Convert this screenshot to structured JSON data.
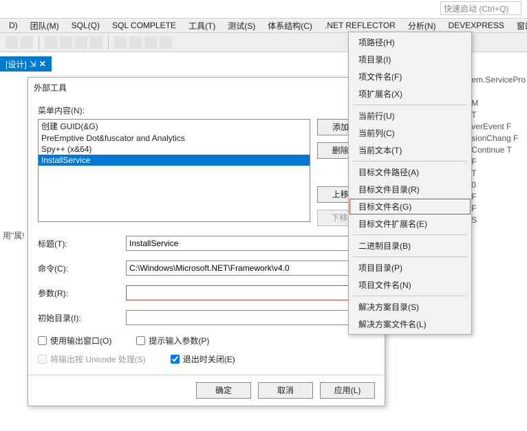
{
  "quicklaunch_placeholder": "快速启动 (Ctrl+Q)",
  "menubar": [
    "D)",
    "团队(M)",
    "SQL(Q)",
    "SQL COMPLETE",
    "工具(T)",
    "测试(S)",
    "体系结构(C)",
    ".NET REFLECTOR",
    "分析(N)",
    "DEVEXPRESS",
    "窗口"
  ],
  "doctab": {
    "label": "[设计]",
    "pin": "⇲",
    "close": "✕"
  },
  "hint_text": "用\"属!",
  "peek_lines": [
    "em.ServicePro",
    "",
    "M",
    "T",
    "verEvent    F",
    "sionChang  F",
    "Continue    T",
    "F",
    "T",
    "0",
    "F",
    "F",
    "S"
  ],
  "dialog": {
    "title": "外部工具",
    "help": "?",
    "close": "✕",
    "label_menu": "菜单内容(N):",
    "list": [
      "创建 GUID(&G)",
      "PreEmptive Dot&fuscator and Analytics",
      "Spy++ (x&64)",
      "InstallService"
    ],
    "selected_index": 3,
    "btns": {
      "add": "添加(A)",
      "del": "删除(D)",
      "up": "上移(U)",
      "down": "下移(W)"
    },
    "fields": {
      "title_lbl": "标题(T):",
      "title_val": "InstallService",
      "cmd_lbl": "命令(C):",
      "cmd_val": "C:\\Windows\\Microsoft.NET\\Framework\\v4.0",
      "args_lbl": "参数(R):",
      "args_val": "",
      "initdir_lbl": "初始目录(I):",
      "initdir_val": ""
    },
    "chk": {
      "useoutput": "使用输出窗口(O)",
      "prompt": "提示输入参数(P)",
      "unicode": "将输出按 Unicode 处理(S)",
      "closeonexit": "退出时关闭(E)"
    },
    "footer": {
      "ok": "确定",
      "cancel": "取消",
      "apply": "应用(L)"
    }
  },
  "ctx": [
    "项路径(H)",
    "项目录(I)",
    "项文件名(F)",
    "项扩展名(X)",
    "-",
    "当前行(U)",
    "当前列(C)",
    "当前文本(T)",
    "-",
    "目标文件路径(A)",
    "目标文件目录(R)",
    "目标文件名(G)",
    "目标文件扩展名(E)",
    "-",
    "二进制目录(B)",
    "-",
    "项目目录(P)",
    "项目文件名(N)",
    "-",
    "解决方案目录(S)",
    "解决方案文件名(L)"
  ],
  "ctx_highlight": "目标文件名(G)"
}
